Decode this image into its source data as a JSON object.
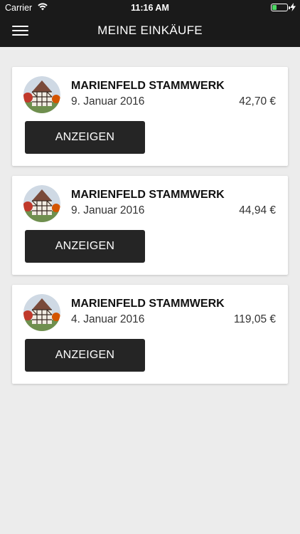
{
  "status_bar": {
    "carrier": "Carrier",
    "time": "11:16 AM"
  },
  "header": {
    "title": "MEINE EINKÄUFE"
  },
  "purchases": [
    {
      "store": "MARIENFELD STAMMWERK",
      "date": "9. Januar 2016",
      "amount": "42,70 €",
      "button": "ANZEIGEN"
    },
    {
      "store": "MARIENFELD STAMMWERK",
      "date": "9. Januar 2016",
      "amount": "44,94 €",
      "button": "ANZEIGEN"
    },
    {
      "store": "MARIENFELD STAMMWERK",
      "date": "4. Januar 2016",
      "amount": "119,05 €",
      "button": "ANZEIGEN"
    }
  ],
  "colors": {
    "header_bg": "#1a1a1a",
    "background": "#ececec",
    "button_bg": "#252525",
    "battery_fill": "#4cd964"
  },
  "icons": [
    "wifi-icon",
    "battery-icon",
    "charging-bolt-icon",
    "menu-icon",
    "store-avatar"
  ]
}
